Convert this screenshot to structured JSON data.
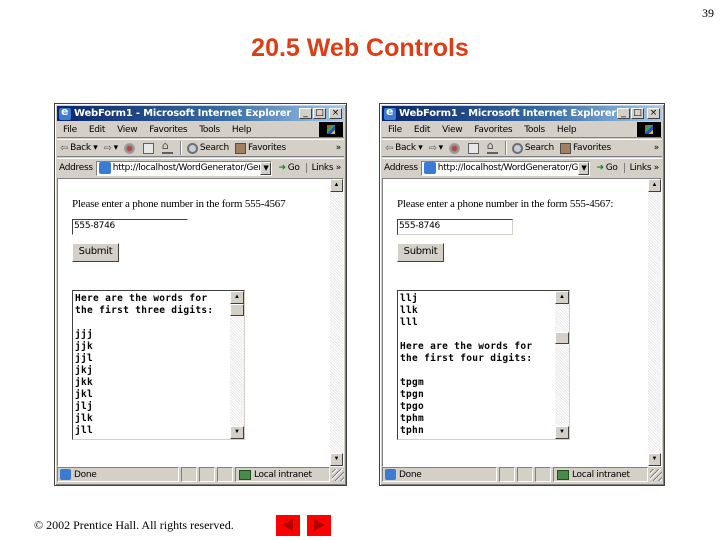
{
  "slide": {
    "page_number": "39",
    "title": "20.5 Web Controls",
    "footer_copyright": "© 2002 Prentice Hall.  All rights reserved.",
    "nav": {
      "prev_icon": "previous-slide-arrow",
      "next_icon": "next-slide-arrow"
    },
    "colors": {
      "title": "#e03c14",
      "nav_button": "#ff0000"
    }
  },
  "windows": [
    {
      "title": "WebForm1 - Microsoft Internet Explorer",
      "title_buttons": [
        "_",
        "□",
        "×"
      ],
      "menu": [
        "File",
        "Edit",
        "View",
        "Favorites",
        "Tools",
        "Help"
      ],
      "toolbar": {
        "back": "Back",
        "search": "Search",
        "favorites": "Favorites",
        "more": "»"
      },
      "address": {
        "label": "Address",
        "url": "http://localhost/WordGenerator/Genera",
        "go": "Go",
        "links": "Links",
        "links_more": "»"
      },
      "form": {
        "prompt": "Please enter a phone number in the form 555-4567",
        "phone_value": "555-8746",
        "submit_label": "Submit"
      },
      "results": {
        "text": "Here are the words for\nthe first three digits:\n\njjj\njjk\njjl\njkj\njkk\njkl\njlj\njlk\njll",
        "scroll_position": 0.0
      },
      "status": {
        "text": "Done",
        "zone": "Local intranet"
      }
    },
    {
      "title": "WebForm1 - Microsoft Internet Explorer",
      "title_buttons": [
        "_",
        "□",
        "×"
      ],
      "menu": [
        "File",
        "Edit",
        "View",
        "Favorites",
        "Tools",
        "Help"
      ],
      "toolbar": {
        "back": "Back",
        "search": "Search",
        "favorites": "Favorites",
        "more": "»"
      },
      "address": {
        "label": "Address",
        "url": "http://localhost/WordGenerator/Genera",
        "go": "Go",
        "links": "Links",
        "links_more": "»"
      },
      "form": {
        "prompt": "Please enter a phone number in the form 555-4567:",
        "phone_value": "555-8746",
        "submit_label": "Submit"
      },
      "results": {
        "text": "llj\nllk\nlll\n\nHere are the words for\nthe first four digits:\n\ntpgm\ntpgn\ntpgo\ntphm\ntphn",
        "scroll_position": 0.25
      },
      "status": {
        "text": "Done",
        "zone": "Local intranet"
      }
    }
  ]
}
